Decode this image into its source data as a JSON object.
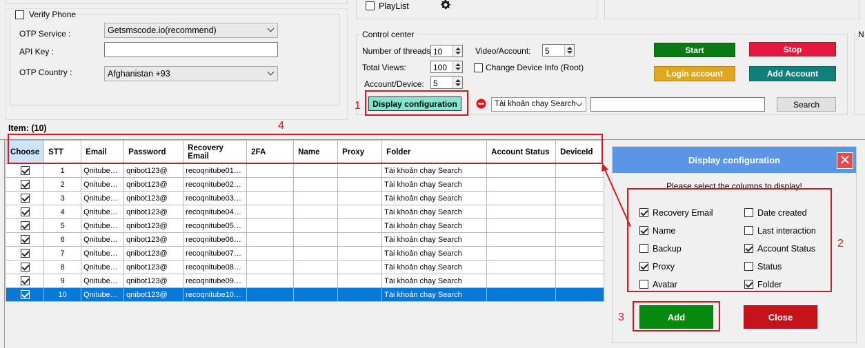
{
  "verify": {
    "verify_phone_label": "Verify Phone",
    "otp_service_label": "OTP Service :",
    "otp_service_value": "Getsmscode.io(recommend)",
    "api_key_label": "API Key :",
    "api_key_value": "",
    "otp_country_label": "OTP Country :",
    "otp_country_value": "Afghanistan +93"
  },
  "playlist": {
    "label": "PlayList",
    "icon": "gear-icon"
  },
  "control": {
    "title": "Control center",
    "threads_label": "Number of threads:",
    "threads_value": "10",
    "views_label": "Total Views:",
    "views_value": "100",
    "acc_device_label": "Account/Device:",
    "acc_device_value": "5",
    "video_acc_label": "Video/Account:",
    "video_acc_value": "5",
    "change_device_label": "Change Device Info (Root)",
    "start_label": "Start",
    "stop_label": "Stop",
    "login_label": "Login account",
    "add_account_label": "Add Account",
    "display_config_label": "Display configuration",
    "folder_combo_value": "Tài khoản chạy Search",
    "search_value": "",
    "search_button": "Search",
    "right_label": "N"
  },
  "item_count": "Item: (10)",
  "annotations": {
    "n1": "1",
    "n2": "2",
    "n3": "3",
    "n4": "4"
  },
  "table": {
    "headers": [
      "Choose",
      "STT",
      "Email",
      "Password",
      "Recovery Email",
      "2FA",
      "Name",
      "Proxy",
      "Folder",
      "Account Status",
      "DeviceId"
    ],
    "rows": [
      {
        "stt": "1",
        "email": "Qnitube…",
        "password": "qnibot123@",
        "recovery": "recoqnitube01…",
        "folder": "Tài khoản chạy Search"
      },
      {
        "stt": "2",
        "email": "Qnitube…",
        "password": "qnibot123@",
        "recovery": "recoqnitube02…",
        "folder": "Tài khoản chạy Search"
      },
      {
        "stt": "3",
        "email": "Qnitube…",
        "password": "qnibot123@",
        "recovery": "recoqnitube03…",
        "folder": "Tài khoản chạy Search"
      },
      {
        "stt": "4",
        "email": "Qnitube…",
        "password": "qnibot123@",
        "recovery": "recoqnitube04…",
        "folder": "Tài khoản chạy Search"
      },
      {
        "stt": "5",
        "email": "Qnitube…",
        "password": "qnibot123@",
        "recovery": "recoqnitube05…",
        "folder": "Tài khoản chạy Search"
      },
      {
        "stt": "6",
        "email": "Qnitube…",
        "password": "qnibot123@",
        "recovery": "recoqnitube06…",
        "folder": "Tài khoản chạy Search"
      },
      {
        "stt": "7",
        "email": "Qnitube…",
        "password": "qnibot123@",
        "recovery": "recoqnitube07…",
        "folder": "Tài khoản chạy Search"
      },
      {
        "stt": "8",
        "email": "Qnitube…",
        "password": "qnibot123@",
        "recovery": "recoqnitube08…",
        "folder": "Tài khoản chạy Search"
      },
      {
        "stt": "9",
        "email": "Qnitube…",
        "password": "qnibot123@",
        "recovery": "recoqnitube09…",
        "folder": "Tài khoản chạy Search"
      },
      {
        "stt": "10",
        "email": "Qnitube…",
        "password": "qnibot123@",
        "recovery": "recoqnitube10…",
        "folder": "Tài khoản chạy Search"
      }
    ]
  },
  "dialog": {
    "title": "Display configuration",
    "close": "✕",
    "prompt": "Please select the columns to display!",
    "options_left": [
      {
        "label": "Recovery Email",
        "checked": true
      },
      {
        "label": "Name",
        "checked": true
      },
      {
        "label": "Backup",
        "checked": false
      },
      {
        "label": "Proxy",
        "checked": true
      },
      {
        "label": "Avatar",
        "checked": false
      }
    ],
    "options_right": [
      {
        "label": "Date created",
        "checked": false
      },
      {
        "label": "Last interaction",
        "checked": false
      },
      {
        "label": "Account Status",
        "checked": true
      },
      {
        "label": "Status",
        "checked": false
      },
      {
        "label": "Folder",
        "checked": true
      }
    ],
    "add_label": "Add",
    "close_label": "Close"
  },
  "colors": {
    "start": "#0b7a14",
    "stop": "#e5173f",
    "login": "#dfa81e",
    "add_account": "#128078",
    "display_config": "#7ee8cf",
    "selected_row": "#0a78d7",
    "dialog_header": "#5b95e6",
    "add": "#078a0f",
    "close": "#c8121b",
    "annotation": "#e0141b"
  }
}
